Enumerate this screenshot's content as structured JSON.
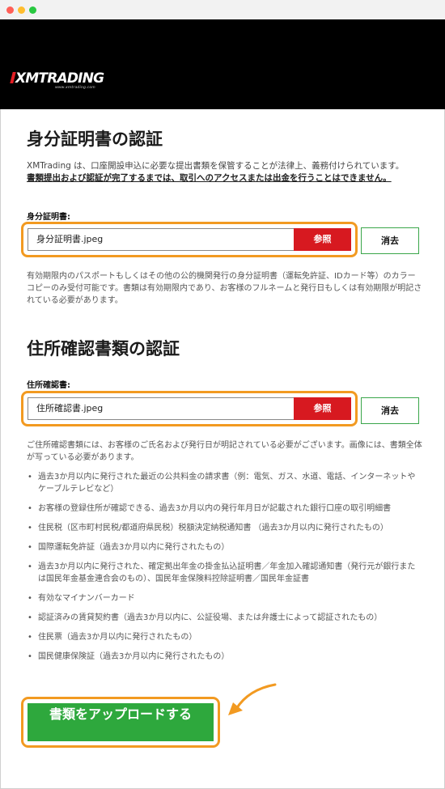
{
  "header": {
    "logo_text": "XMTRADING",
    "logo_sub": "www.xmtrading.com"
  },
  "identity": {
    "title": "身分証明書の認証",
    "intro_plain": "XMTrading は、口座開設申込に必要な提出書類を保管することが法律上、義務付けられています。",
    "intro_emph": "書類提出および認証が完了するまでは、取引へのアクセスまたは出金を行うことはできません。",
    "field_label": "身分証明書:",
    "file_value": "身分証明書.jpeg",
    "browse_label": "参照",
    "clear_label": "消去",
    "note": "有効期限内のパスポートもしくはその他の公的機関発行の身分証明書（運転免許証、IDカード等）のカラーコピーのみ受付可能です。書類は有効期限内であり、お客様のフルネームと発行日もしくは有効期限が明記されている必要があります。"
  },
  "address": {
    "title": "住所確認書類の認証",
    "field_label": "住所確認書:",
    "file_value": "住所確認書.jpeg",
    "browse_label": "参照",
    "clear_label": "消去",
    "note": "ご住所確認書類には、お客様のご氏名および発行日が明記されている必要がございます。画像には、書類全体が写っている必要があります。",
    "items": [
      "過去3か月以内に発行された最近の公共料金の請求書（例：電気、ガス、水道、電話、インターネットやケーブルテレビなど）",
      "お客様の登録住所が確認できる、過去3か月以内の発行年月日が記載された銀行口座の取引明細書",
      "住民税（区市町村民税/都道府県民税）税額決定納税通知書 （過去3か月以内に発行されたもの）",
      "国際運転免許証（過去3か月以内に発行されたもの）",
      "過去3か月以内に発行された、確定拠出年金の掛金払込証明書／年金加入確認通知書（発行元が銀行または国民年金基金連合会のもの）、国民年金保険料控除証明書／国民年金証書",
      "有効なマイナンバーカード",
      "認証済みの賃貸契約書（過去3か月以内に、公証役場、または弁護士によって認証されたもの）",
      "住民票（過去3か月以内に発行されたもの）",
      "国民健康保険証（過去3か月以内に発行されたもの）"
    ]
  },
  "submit": {
    "label": "書類をアップロードする"
  },
  "colors": {
    "accent_orange": "#f29a21",
    "browse_red": "#d71920",
    "submit_green": "#2ea83d"
  }
}
